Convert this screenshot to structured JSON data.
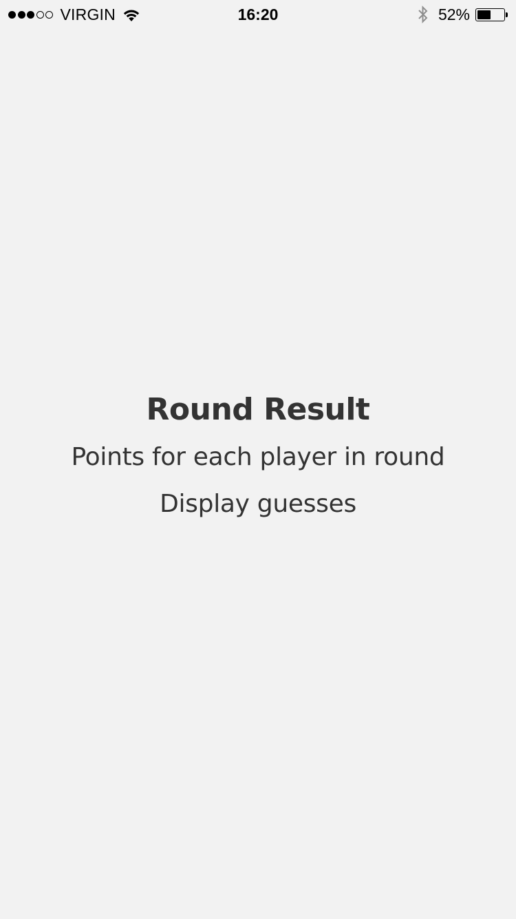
{
  "status_bar": {
    "signal_bars_filled": 3,
    "signal_bars_total": 5,
    "carrier": "VIRGIN",
    "wifi_icon": "wifi-icon",
    "time": "16:20",
    "bluetooth_icon": "bluetooth-icon",
    "battery_percent_label": "52%",
    "battery_level": 0.52
  },
  "main": {
    "title": "Round Result",
    "line1": "Points for each player in round",
    "line2": "Display guesses"
  },
  "colors": {
    "background": "#f2f2f2",
    "text": "#333333"
  }
}
